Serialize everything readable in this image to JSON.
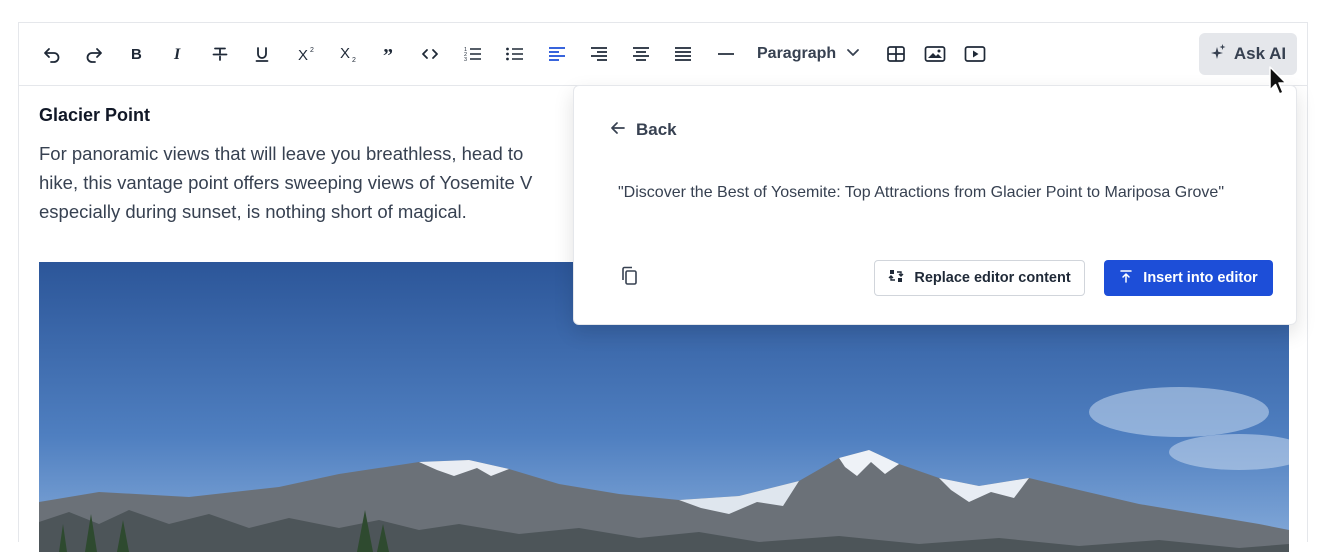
{
  "toolbar": {
    "paragraph_style": "Paragraph",
    "ask_ai_label": "Ask AI",
    "active_color": "#1d4ed8",
    "icons": [
      "undo-icon",
      "redo-icon",
      "bold-icon",
      "italic-icon",
      "strikethrough-icon",
      "underline-icon",
      "superscript-icon",
      "subscript-icon",
      "blockquote-icon",
      "code-icon",
      "ordered-list-icon",
      "bullet-list-icon",
      "align-left-icon",
      "align-right-icon",
      "align-center-icon",
      "align-justify-icon",
      "horizontal-rule-icon",
      "table-icon",
      "image-icon",
      "video-icon"
    ]
  },
  "content": {
    "heading": "Glacier Point",
    "paragraph_lines": [
      "For panoramic views that will leave you breathless, head to",
      "hike, this vantage point offers sweeping views of Yosemite V",
      "especially during sunset, is nothing short of magical."
    ]
  },
  "ai_popup": {
    "back_label": "Back",
    "suggestion": "\"Discover the Best of Yosemite: Top Attractions from Glacier Point to Mariposa Grove\"",
    "replace_label": "Replace editor content",
    "insert_label": "Insert into editor",
    "insert_color": "#1d4ed8"
  }
}
